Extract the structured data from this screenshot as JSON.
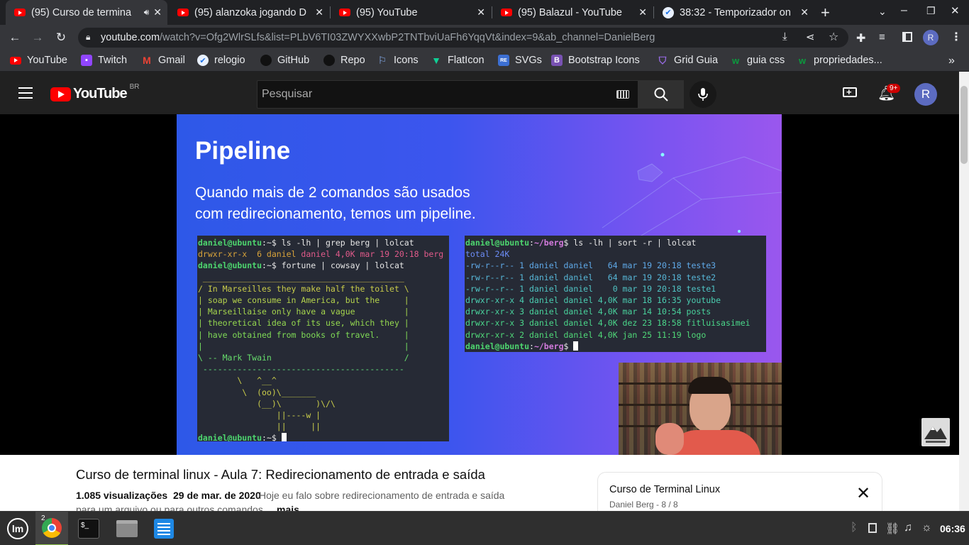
{
  "browser": {
    "tabs": [
      {
        "title": "(95) Curso de termina",
        "favicon": "youtube-icon",
        "active": true,
        "audio": true
      },
      {
        "title": "(95) alanzoka jogando D",
        "favicon": "youtube-icon",
        "active": false
      },
      {
        "title": "(95) YouTube",
        "favicon": "youtube-icon",
        "active": false
      },
      {
        "title": "(95) Balazul - YouTube",
        "favicon": "youtube-icon",
        "active": false
      },
      {
        "title": "38:32 - Temporizador on",
        "favicon": "timer-icon",
        "active": false
      }
    ],
    "url_host": "youtube.com",
    "url_path": "/watch?v=Ofg2WlrSLfs&list=PLbV6TI03ZWYXXwbP2TNTbviUaFh6YqqVt&index=9&ab_channel=DanielBerg",
    "profile_initial": "R",
    "bookmarks": [
      {
        "label": "YouTube",
        "icon": "youtube-icon",
        "color": "#ff0000"
      },
      {
        "label": "Twitch",
        "icon": "twitch-icon",
        "color": "#9146ff"
      },
      {
        "label": "Gmail",
        "icon": "gmail-icon",
        "color": "#ea4335"
      },
      {
        "label": "relogio",
        "icon": "clock-icon",
        "color": "#4285f4"
      },
      {
        "label": "GitHub",
        "icon": "github-icon",
        "color": "#202124"
      },
      {
        "label": "Repo",
        "icon": "github-icon",
        "color": "#202124"
      },
      {
        "label": "Icons",
        "icon": "flag-icon",
        "color": "#4285f4"
      },
      {
        "label": "FlatIcon",
        "icon": "flaticon-icon",
        "color": "#0fcf95"
      },
      {
        "label": "SVGs",
        "icon": "svgrepo-icon",
        "color": "#3c6fd3"
      },
      {
        "label": "Bootstrap Icons",
        "icon": "bootstrap-icon",
        "color": "#7952b3"
      },
      {
        "label": "Grid Guia",
        "icon": "grid-icon",
        "color": "#7d4cdb"
      },
      {
        "label": "guia css",
        "icon": "origamid-icon",
        "color": "#0b9a3e"
      },
      {
        "label": "propriedades...",
        "icon": "origamid-icon",
        "color": "#0b9a3e"
      }
    ]
  },
  "youtube": {
    "logo_text": "YouTube",
    "country": "BR",
    "search_placeholder": "Pesquisar",
    "notifications": "9+",
    "avatar_initial": "R"
  },
  "slide": {
    "title": "Pipeline",
    "subtitle_line1": "Quando mais de 2 comandos são usados",
    "subtitle_line2": "com redirecionamento, temos um pipeline."
  },
  "video": {
    "title": "Curso de terminal linux - Aula 7: Redirecionamento de entrada e saída",
    "views": "1.085 visualizações",
    "date": "29 de mar. de 2020",
    "description_line1": "Hoje eu falo sobre redirecionamento de entrada e saída",
    "description_line2": "para um arquivo ou para outros comandos",
    "more": "mais"
  },
  "playlist": {
    "title": "Curso de Terminal Linux",
    "subtitle": "Daniel Berg - 8 / 8"
  },
  "taskbar": {
    "chrome_badge": "2",
    "clock": "06:36"
  }
}
